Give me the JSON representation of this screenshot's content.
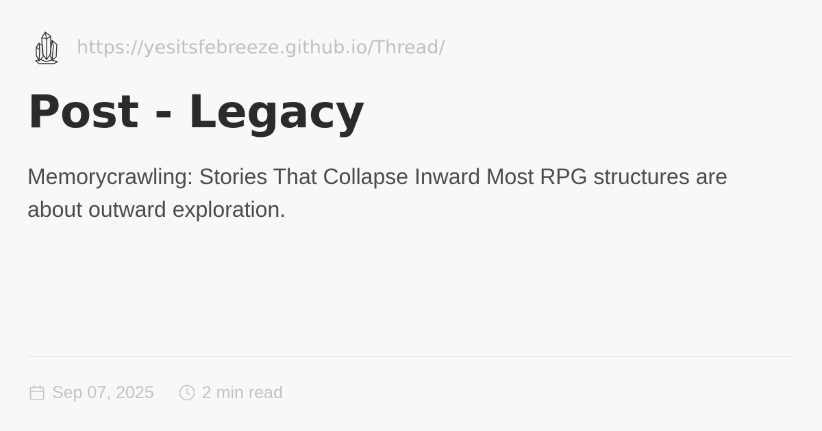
{
  "site": {
    "url": "https://yesitsfebreeze.github.io/Thread/",
    "logo_icon": "crystal-cluster-icon"
  },
  "post": {
    "title": "Post - Legacy",
    "description": "Memorycrawling: Stories That Collapse Inward Most RPG structures are about outward exploration."
  },
  "meta": {
    "date_icon": "calendar-icon",
    "date": "Sep 07, 2025",
    "read_time_icon": "clock-icon",
    "read_time": "2 min read"
  },
  "colors": {
    "background": "#f9f8f9",
    "title": "#2b2a2c",
    "body": "#4c4b4e",
    "muted": "#c0bfc2",
    "divider": "#e6e5e7"
  }
}
